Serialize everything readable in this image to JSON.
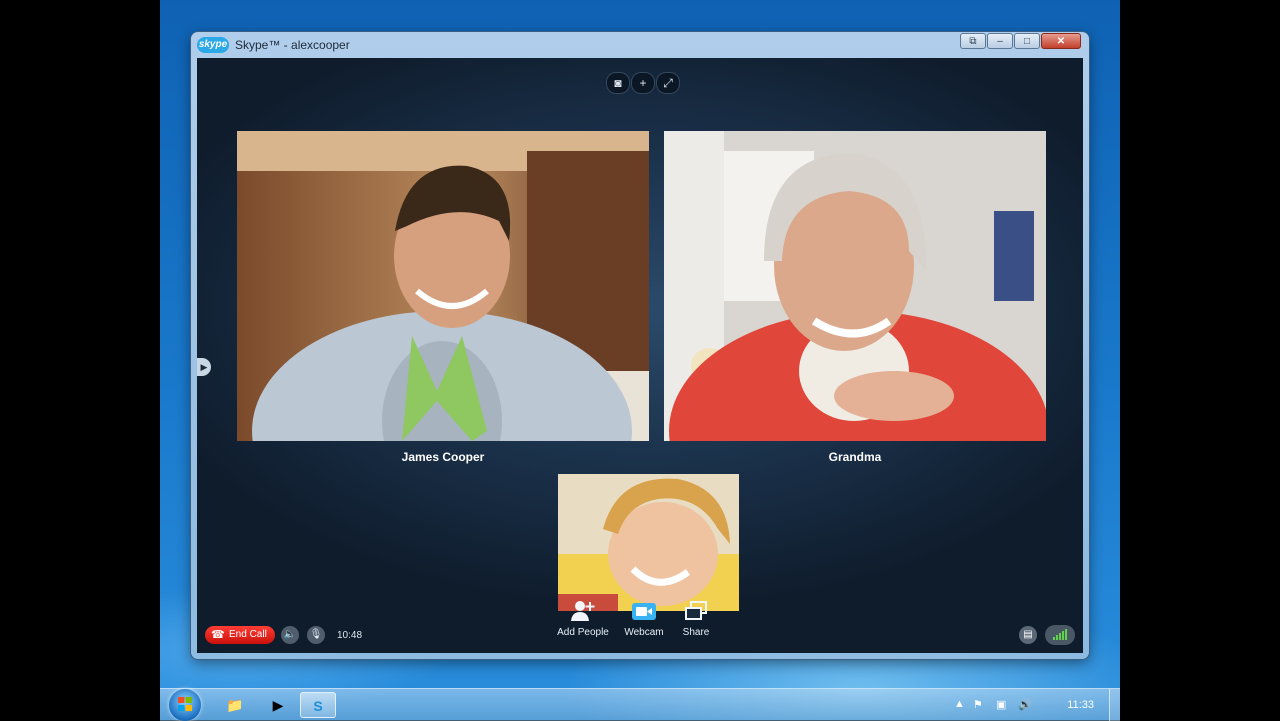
{
  "window": {
    "title": "Skype™ - alexcooper",
    "logo_text": "skype"
  },
  "title_bar": {
    "buttons": [
      "restore-compact",
      "minimize",
      "maximize",
      "close"
    ]
  },
  "call": {
    "top_tools": [
      "camera-icon",
      "plus-icon",
      "fullscreen-icon"
    ],
    "participants": [
      {
        "name": "James Cooper"
      },
      {
        "name": "Grandma"
      }
    ],
    "self_view": {
      "label": ""
    },
    "controls": {
      "end_call_label": "End Call",
      "duration": "10:48",
      "actions": [
        {
          "label": "Add People",
          "icon": "add-person-icon"
        },
        {
          "label": "Webcam",
          "icon": "webcam-icon"
        },
        {
          "label": "Share",
          "icon": "share-icon"
        }
      ]
    }
  },
  "taskbar": {
    "clock": "11:33",
    "apps": [
      "explorer-icon",
      "media-player-icon",
      "skype-icon"
    ],
    "tray_icons": [
      "show-hidden-icon",
      "action-center-flag-icon",
      "network-icon",
      "volume-icon"
    ]
  },
  "colors": {
    "end_call": "#e8120b",
    "signal_green": "#5fd44b",
    "webcam_active": "#38b2f2"
  }
}
